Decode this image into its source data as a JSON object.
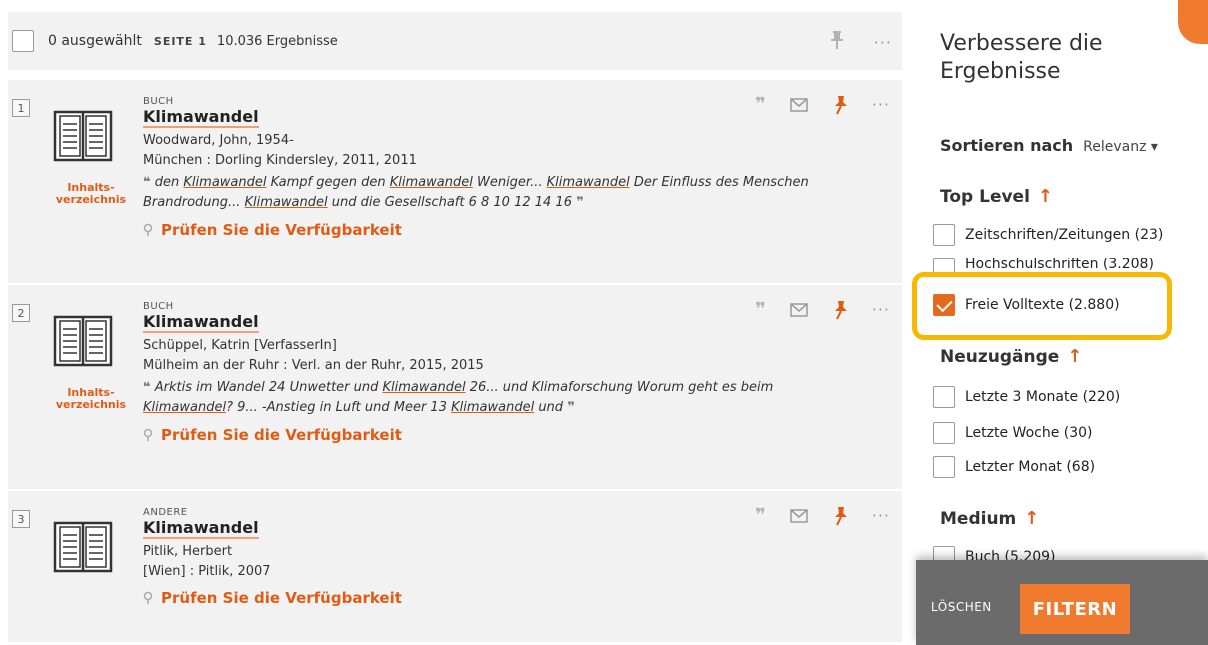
{
  "topbar": {
    "selected": "0 ausgewählt",
    "page": "SEITE 1",
    "results": "10.036 Ergebnisse",
    "pin_icon": "pin-icon",
    "more_icon": "more-icon"
  },
  "results": [
    {
      "num": "1",
      "type": "BUCH",
      "title": "Klimawandel",
      "author": "Woodward, John, 1954-",
      "pub": "München : Dorling Kindersley, 2011, 2011",
      "toc_line1": "Inhalts-",
      "toc_line2": "verzeichnis",
      "snip": [
        "den ",
        "Klimawandel",
        " Kampf gegen den ",
        "Klimawandel",
        " Weniger... ",
        "Klimawandel",
        " Der Einfluss des Menschen Brandrodung... ",
        "Klimawandel",
        " und die Gesellschaft 6 8 10 12 14 16"
      ],
      "avail": "Prüfen Sie die Verfügbarkeit"
    },
    {
      "num": "2",
      "type": "BUCH",
      "title": "Klimawandel",
      "author": "Schüppel, Katrin [VerfasserIn]",
      "pub": "Mülheim an der Ruhr : Verl. an der Ruhr, 2015, 2015",
      "toc_line1": "Inhalts-",
      "toc_line2": "verzeichnis",
      "snip": [
        "Arktis im Wandel 24 Unwetter und ",
        "Klimawandel",
        " 26... und Klimaforschung Worum geht es beim ",
        "Klimawandel",
        "? 9... -Anstieg in Luft und Meer 13 ",
        "Klimawandel",
        " und"
      ],
      "avail": "Prüfen Sie die Verfügbarkeit"
    },
    {
      "num": "3",
      "type": "ANDERE",
      "title": "Klimawandel",
      "author": "Pitlik, Herbert",
      "pub": "[Wien] : Pitlik, 2007",
      "avail": "Prüfen Sie die Verfügbarkeit"
    }
  ],
  "sidebar": {
    "title": "Verbessere die Ergebnisse",
    "sort_label": "Sortieren nach",
    "sort_value": "Relevanz ▾",
    "top_level": "Top Level",
    "top_items": [
      "Zeitschriften/Zeitungen (23)",
      "Hochschulschriften (3.208)",
      "Freie Volltexte (2.880)"
    ],
    "new_label": "Neuzugänge",
    "new_items": [
      "Letzte 3 Monate (220)",
      "Letzte Woche (30)",
      "Letzter Monat (68)"
    ],
    "medium_label": "Medium",
    "medium_items": [
      "Buch (5.209)"
    ],
    "arrow": "↑",
    "clear": "LÖSCHEN",
    "filter": "FILTERN"
  },
  "colors": {
    "accent": "#e05c14",
    "highlight": "#f6b800"
  }
}
